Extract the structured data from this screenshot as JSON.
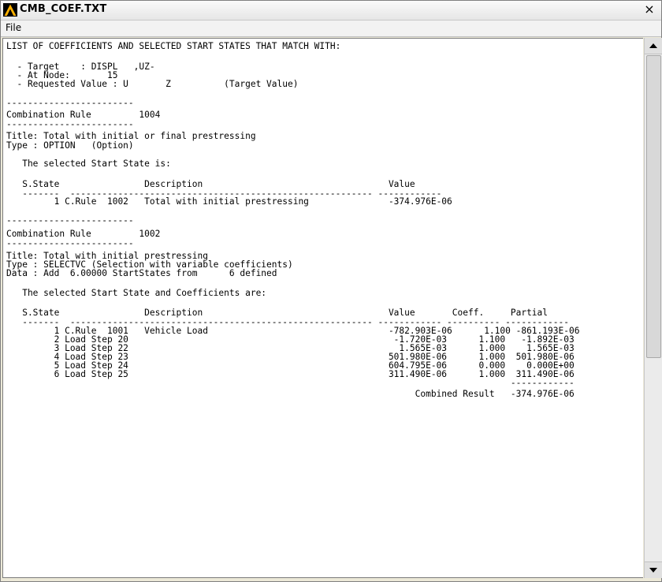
{
  "window": {
    "title": "CMB_COEF.TXT",
    "close_label": "×"
  },
  "menu": {
    "file": "File"
  },
  "text_lines": [
    "LIST OF COEFFICIENTS AND SELECTED START STATES THAT MATCH WITH:",
    "",
    "  - Target    : DISPL   ,UZ-",
    "  - At Node:       15",
    "  - Requested Value : U       Z          (Target Value)",
    "",
    "------------------------",
    "Combination Rule         1004",
    "------------------------",
    "Title: Total with initial or final prestressing",
    "Type : OPTION   (Option)",
    "",
    "   The selected Start State is:",
    "",
    "   S.State                Description                                   Value",
    "   -------  --------------------------------------------------------- ------------",
    "         1 C.Rule  1002   Total with initial prestressing               -374.976E-06",
    "",
    "------------------------",
    "Combination Rule         1002",
    "------------------------",
    "Title: Total with initial prestressing",
    "Type : SELECTVC (Selection with variable coefficients)",
    "Data : Add  6.00000 StartStates from      6 defined",
    "",
    "   The selected Start State and Coefficients are:",
    "",
    "   S.State                Description                                   Value       Coeff.     Partial",
    "   -------  --------------------------------------------------------- ------------ ---------- ------------",
    "         1 C.Rule  1001   Vehicle Load                                  -782.903E-06      1.100 -861.193E-06",
    "         2 Load Step 20                                                  -1.720E-03      1.100   -1.892E-03",
    "         3 Load Step 22                                                   1.565E-03      1.000    1.565E-03",
    "         4 Load Step 23                                                 501.980E-06      1.000  501.980E-06",
    "         5 Load Step 24                                                 604.795E-06      0.000    0.000E+00",
    "         6 Load Step 25                                                 311.490E-06      1.000  311.490E-06",
    "                                                                                               ------------",
    "                                                                             Combined Result   -374.976E-06"
  ]
}
